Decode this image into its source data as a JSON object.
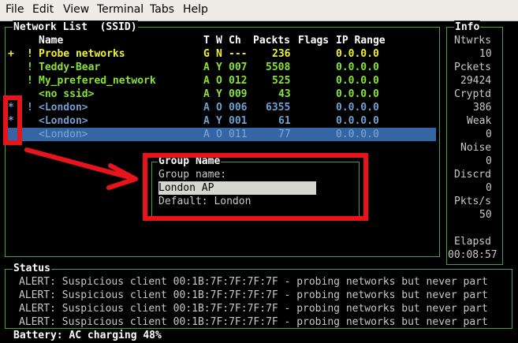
{
  "menu": [
    "File",
    "Edit",
    "View",
    "Terminal",
    "Tabs",
    "Help"
  ],
  "network_list": {
    "title": "Network List  (SSID)",
    "columns": {
      "name": "Name",
      "type": "T",
      "wep": "W",
      "channel": "Ch",
      "packets": "Packts",
      "flags": "Flags",
      "ip_range": "IP Range"
    },
    "rows": [
      {
        "mark": "+",
        "flag": "!",
        "name": "Probe networks",
        "type": "G",
        "wep": "N",
        "channel": "---",
        "packets": "236",
        "ip": "0.0.0.0",
        "color": "yellow"
      },
      {
        "mark": "",
        "flag": "!",
        "name": "Teddy-Bear",
        "type": "A",
        "wep": "Y",
        "channel": "007",
        "packets": "5508",
        "ip": "0.0.0.0",
        "color": "green"
      },
      {
        "mark": "",
        "flag": "!",
        "name": "My_prefered_network",
        "type": "A",
        "wep": "O",
        "channel": "012",
        "packets": "525",
        "ip": "0.0.0.0",
        "color": "green"
      },
      {
        "mark": "",
        "flag": "",
        "name": "<no ssid>",
        "type": "A",
        "wep": "Y",
        "channel": "009",
        "packets": "43",
        "ip": "0.0.0.0",
        "color": "green"
      },
      {
        "mark": "*",
        "flag": "!",
        "name": "<London>",
        "type": "A",
        "wep": "O",
        "channel": "006",
        "packets": "6355",
        "ip": "0.0.0.0",
        "color": "blue"
      },
      {
        "mark": "*",
        "flag": "",
        "name": "<London>",
        "type": "A",
        "wep": "Y",
        "channel": "001",
        "packets": "61",
        "ip": "0.0.0.0",
        "color": "blue"
      },
      {
        "mark": "",
        "flag": "",
        "name": "<London>",
        "type": "A",
        "wep": "O",
        "channel": "011",
        "packets": "77",
        "ip": "0.0.0.0",
        "color": "selected"
      }
    ]
  },
  "info": {
    "title": "Info",
    "items": [
      {
        "label": "Ntwrks",
        "value": "10"
      },
      {
        "label": "Pckets",
        "value": "29424"
      },
      {
        "label": "Cryptd",
        "value": "386"
      },
      {
        "label": "Weak",
        "value": "0"
      },
      {
        "label": "Noise",
        "value": "0"
      },
      {
        "label": "Discrd",
        "value": "0"
      },
      {
        "label": "Pkts/s",
        "value": "50"
      }
    ],
    "elapsed_label": "Elapsd",
    "elapsed_value": "00:08:57"
  },
  "group_dialog": {
    "title": "Group Name",
    "prompt": "Group name:",
    "input_value": "London AP",
    "default_text": "Default: London"
  },
  "status": {
    "title": "Status",
    "lines": [
      "ALERT: Suspicious client 00:1B:7F:7F:7F:7F - probing networks but never part",
      "ALERT: Suspicious client 00:1B:7F:7F:7F:7F - probing networks but never part",
      "ALERT: Suspicious client 00:1B:7F:7F:7F:7F - probing networks but never part",
      "ALERT: Suspicious client 00:1B:7F:7F:7F:7F - probing networks but never part"
    ],
    "battery": "Battery: AC charging 48%"
  },
  "colors": {
    "accent_red": "#e8141c",
    "frame_green": "#4aa02c",
    "selection_blue": "#3465a4"
  }
}
